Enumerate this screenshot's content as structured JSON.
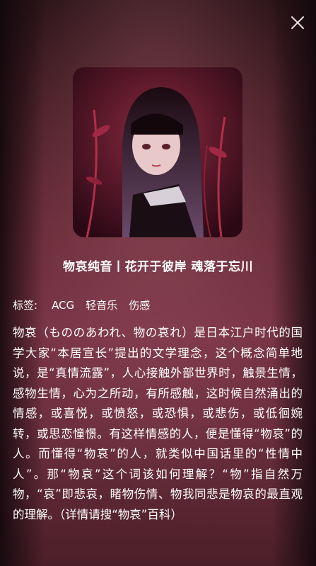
{
  "title": "物哀纯音丨花开于彼岸 魂落于忘川",
  "tags_label": "标签:",
  "tags": [
    "ACG",
    "轻音乐",
    "伤感"
  ],
  "description": "物哀（もののあわれ、物の哀れ）是日本江户时代的国学大家“本居宣长”提出的文学理念，这个概念简单地说，是“真情流露”，人心接触外部世界时，触景生情，感物生情，心为之所动，有所感触，这时候自然涌出的情感，或喜悦，或愤怒，或恐惧，或悲伤，或低徊婉转，或思恋憧憬。有这样情感的人，便是懂得“物哀”的人。而懂得“物哀”的人，就类似中国话里的“性情中人”。那“物哀”这个词该如何理解？“物”指自然万物，“哀”即悲哀，睹物伤情、物我同悲是物哀的最直观的理解。（详情请搜“物哀”百科）",
  "icons": {
    "close": "close-icon"
  }
}
